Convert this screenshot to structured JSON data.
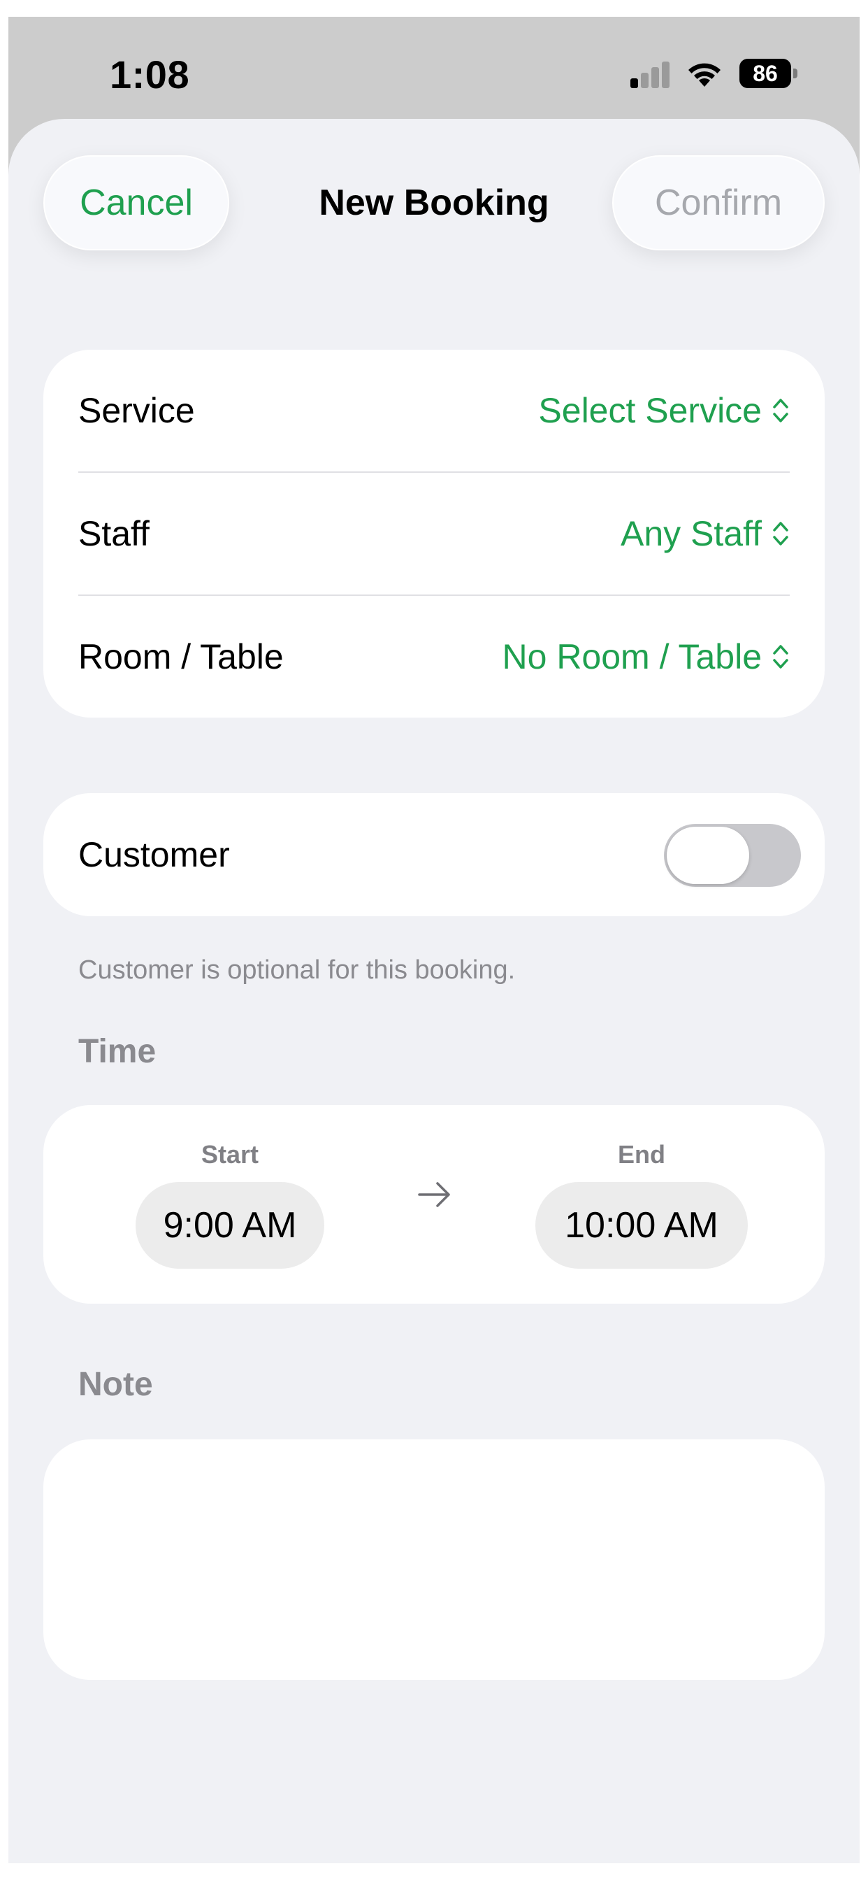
{
  "status_bar": {
    "time": "1:08",
    "battery": "86"
  },
  "nav": {
    "cancel_label": "Cancel",
    "title": "New Booking",
    "confirm_label": "Confirm"
  },
  "pickers": [
    {
      "label": "Service",
      "value": "Select Service"
    },
    {
      "label": "Staff",
      "value": "Any Staff"
    },
    {
      "label": "Room / Table",
      "value": "No Room / Table"
    }
  ],
  "customer": {
    "label": "Customer",
    "toggle_on": false,
    "helper": "Customer is optional for this booking."
  },
  "time": {
    "section_label": "Time",
    "start_label": "Start",
    "start_value": "9:00 AM",
    "end_label": "End",
    "end_value": "10:00 AM"
  },
  "note": {
    "section_label": "Note",
    "value": ""
  },
  "colors": {
    "accent": "#1fa04f",
    "disabled": "#a6a8ad",
    "background": "#f0f1f5"
  }
}
